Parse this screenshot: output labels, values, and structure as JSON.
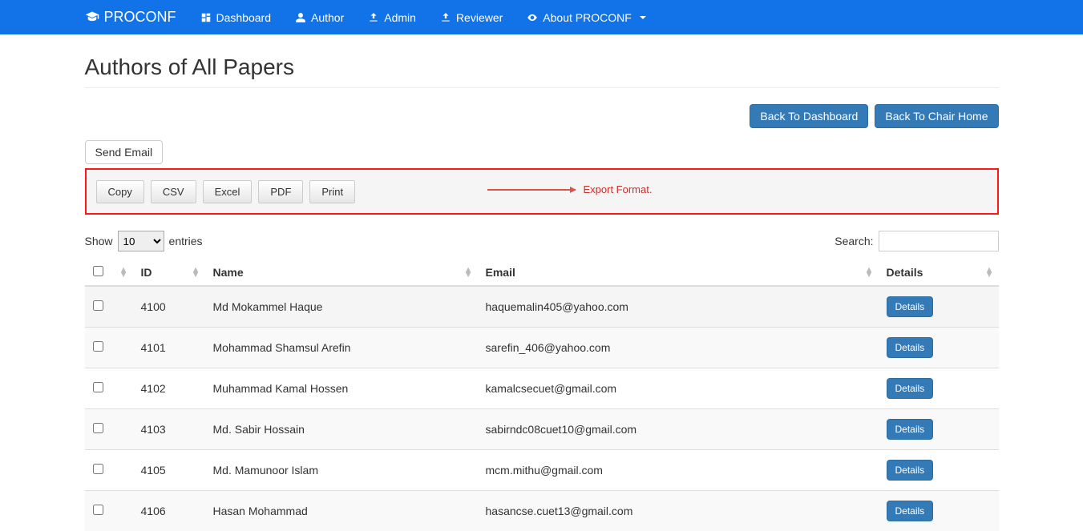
{
  "brand": "PROCONF",
  "nav": {
    "dashboard": "Dashboard",
    "author": "Author",
    "admin": "Admin",
    "reviewer": "Reviewer",
    "about": "About PROCONF"
  },
  "page_title": "Authors of All Papers",
  "buttons": {
    "back_dashboard": "Back To Dashboard",
    "back_chair": "Back To Chair Home",
    "send_email": "Send Email",
    "copy": "Copy",
    "csv": "CSV",
    "excel": "Excel",
    "pdf": "PDF",
    "print": "Print",
    "details": "Details"
  },
  "annotation": "Export Format.",
  "table": {
    "show_label": "Show",
    "entries_label": "entries",
    "page_size": "10",
    "search_label": "Search:",
    "headers": {
      "id": "ID",
      "name": "Name",
      "email": "Email",
      "details": "Details"
    },
    "rows": [
      {
        "id": "4100",
        "name": "Md Mokammel Haque",
        "email": "haquemalin405@yahoo.com"
      },
      {
        "id": "4101",
        "name": "Mohammad Shamsul Arefin",
        "email": "sarefin_406@yahoo.com"
      },
      {
        "id": "4102",
        "name": "Muhammad Kamal Hossen",
        "email": "kamalcsecuet@gmail.com"
      },
      {
        "id": "4103",
        "name": "Md. Sabir Hossain",
        "email": "sabirndc08cuet10@gmail.com"
      },
      {
        "id": "4105",
        "name": "Md. Mamunoor Islam",
        "email": "mcm.mithu@gmail.com"
      },
      {
        "id": "4106",
        "name": "Hasan Mohammad",
        "email": "hasancse.cuet13@gmail.com"
      }
    ]
  }
}
